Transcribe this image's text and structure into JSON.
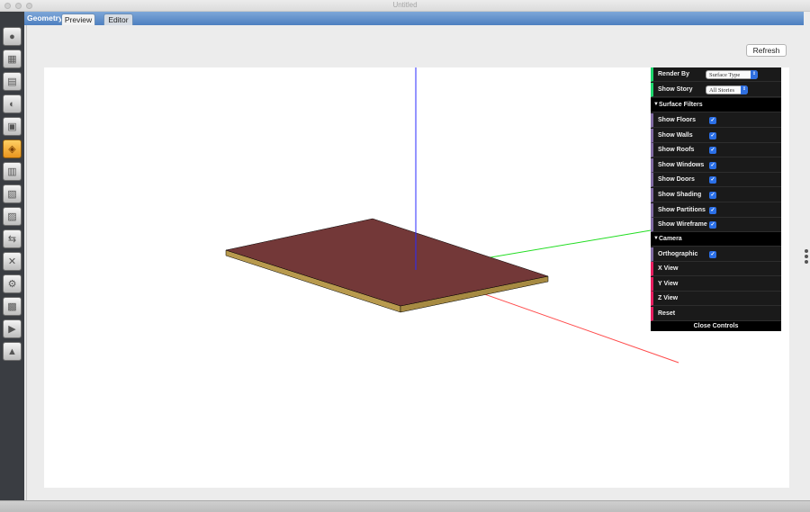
{
  "window": {
    "title": "Untitled"
  },
  "sidebar": {
    "tools": [
      {
        "icon": "site-icon",
        "glyph": "●"
      },
      {
        "icon": "schedules-icon",
        "glyph": "▦"
      },
      {
        "icon": "constructions-icon",
        "glyph": "▤"
      },
      {
        "icon": "loads-icon",
        "glyph": "◐"
      },
      {
        "icon": "space-types-icon",
        "glyph": "▣"
      },
      {
        "icon": "geometry-icon",
        "glyph": "◈",
        "active": true
      },
      {
        "icon": "facility-icon",
        "glyph": "▥"
      },
      {
        "icon": "spaces-icon",
        "glyph": "▧"
      },
      {
        "icon": "thermal-zones-icon",
        "glyph": "▨"
      },
      {
        "icon": "hvac-systems-icon",
        "glyph": "⇆"
      },
      {
        "icon": "building-summary-icon",
        "glyph": "✕"
      },
      {
        "icon": "output-variables-icon",
        "glyph": "⚙"
      },
      {
        "icon": "simulation-settings-icon",
        "glyph": "▩"
      },
      {
        "icon": "measures-icon",
        "glyph": "▶"
      },
      {
        "icon": "results-summary-icon",
        "glyph": "▲"
      }
    ]
  },
  "tabs": {
    "section_label": "Geometry",
    "items": [
      "Preview",
      "Editor"
    ],
    "active": "Preview"
  },
  "toolbar": {
    "refresh_label": "Refresh"
  },
  "controls": {
    "render_by_label": "Render By",
    "render_by_value": "Surface Type",
    "show_story_label": "Show Story",
    "show_story_value": "All Stories",
    "surface_filters_label": "Surface Filters",
    "filters": [
      {
        "label": "Show Floors",
        "checked": true
      },
      {
        "label": "Show Walls",
        "checked": true
      },
      {
        "label": "Show Roofs",
        "checked": true
      },
      {
        "label": "Show Windows",
        "checked": true
      },
      {
        "label": "Show Doors",
        "checked": true
      },
      {
        "label": "Show Shading",
        "checked": true
      },
      {
        "label": "Show Partitions",
        "checked": true
      },
      {
        "label": "Show Wireframe",
        "checked": true
      }
    ],
    "camera_label": "Camera",
    "orthographic_label": "Orthographic",
    "x_view_label": "X View",
    "y_view_label": "Y View",
    "z_view_label": "Z View",
    "reset_label": "Reset",
    "close_label": "Close Controls"
  },
  "colors": {
    "roof_top": "#733838",
    "floor_edge": "#b89a4e",
    "axis_x": "#ff4b4b",
    "axis_y": "#22dd22",
    "axis_z": "#2a2aff",
    "checkbox": "#2b6fe6"
  }
}
